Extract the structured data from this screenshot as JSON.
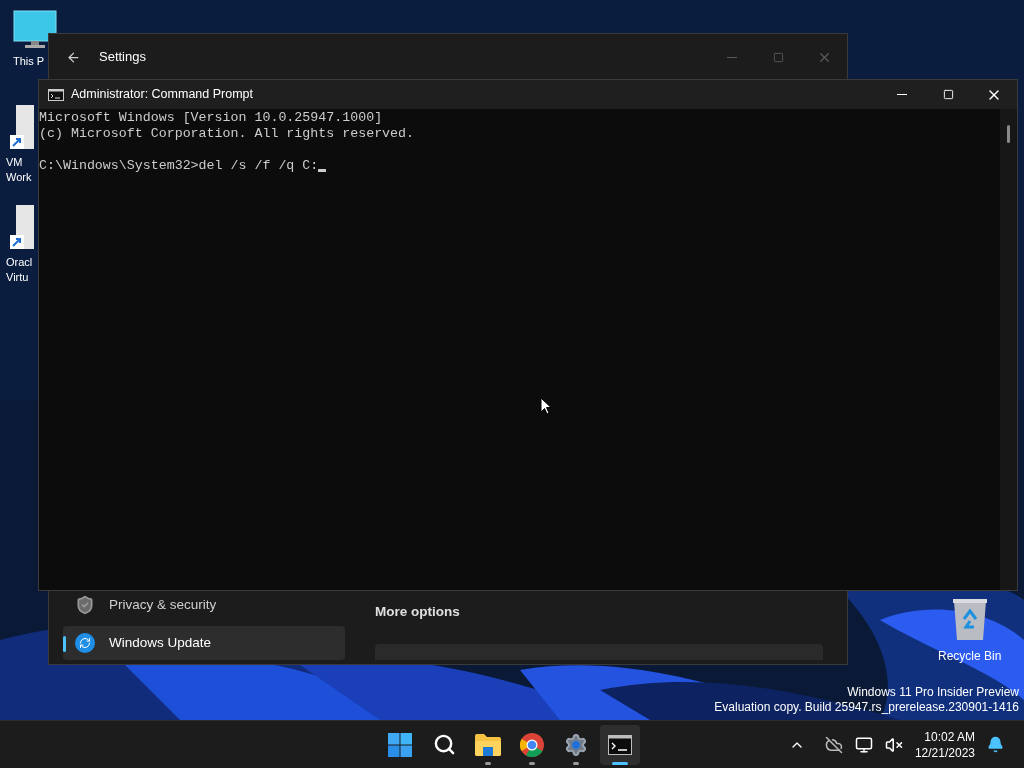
{
  "desktop_icons": [
    {
      "kind": "monitor",
      "lines": [
        "This P"
      ]
    },
    {
      "kind": "shortcut",
      "lines": [
        "VM",
        "Work"
      ]
    },
    {
      "kind": "shortcut",
      "lines": [
        "Oracl",
        "Virtu"
      ]
    }
  ],
  "settings_window": {
    "title": "Settings",
    "sidebar_items": [
      {
        "kind": "shield",
        "label": "Privacy & security",
        "selected": false
      },
      {
        "kind": "update",
        "label": "Windows Update",
        "selected": true
      }
    ],
    "section_heading": "More options"
  },
  "cmd_window": {
    "title": "Administrator: Command Prompt",
    "output_lines": [
      "Microsoft Windows [Version 10.0.25947.1000]",
      "(c) Microsoft Corporation. All rights reserved."
    ],
    "prompt": "C:\\Windows\\System32>del /s /f /q C:"
  },
  "recycle_bin": {
    "label": "Recycle Bin"
  },
  "watermark": [
    "Windows 11 Pro Insider Preview",
    "Evaluation copy. Build 25947.rs_prerelease.230901-1416"
  ],
  "taskbar": {
    "apps": [
      {
        "kind": "start",
        "running": false,
        "selected": false
      },
      {
        "kind": "search",
        "running": false,
        "selected": false
      },
      {
        "kind": "explorer",
        "running": true,
        "selected": false
      },
      {
        "kind": "browser",
        "running": true,
        "selected": false
      },
      {
        "kind": "settings",
        "running": true,
        "selected": false
      },
      {
        "kind": "terminal",
        "running": true,
        "selected": true
      }
    ],
    "clock": {
      "time": "10:02 AM",
      "date": "12/21/2023"
    }
  }
}
